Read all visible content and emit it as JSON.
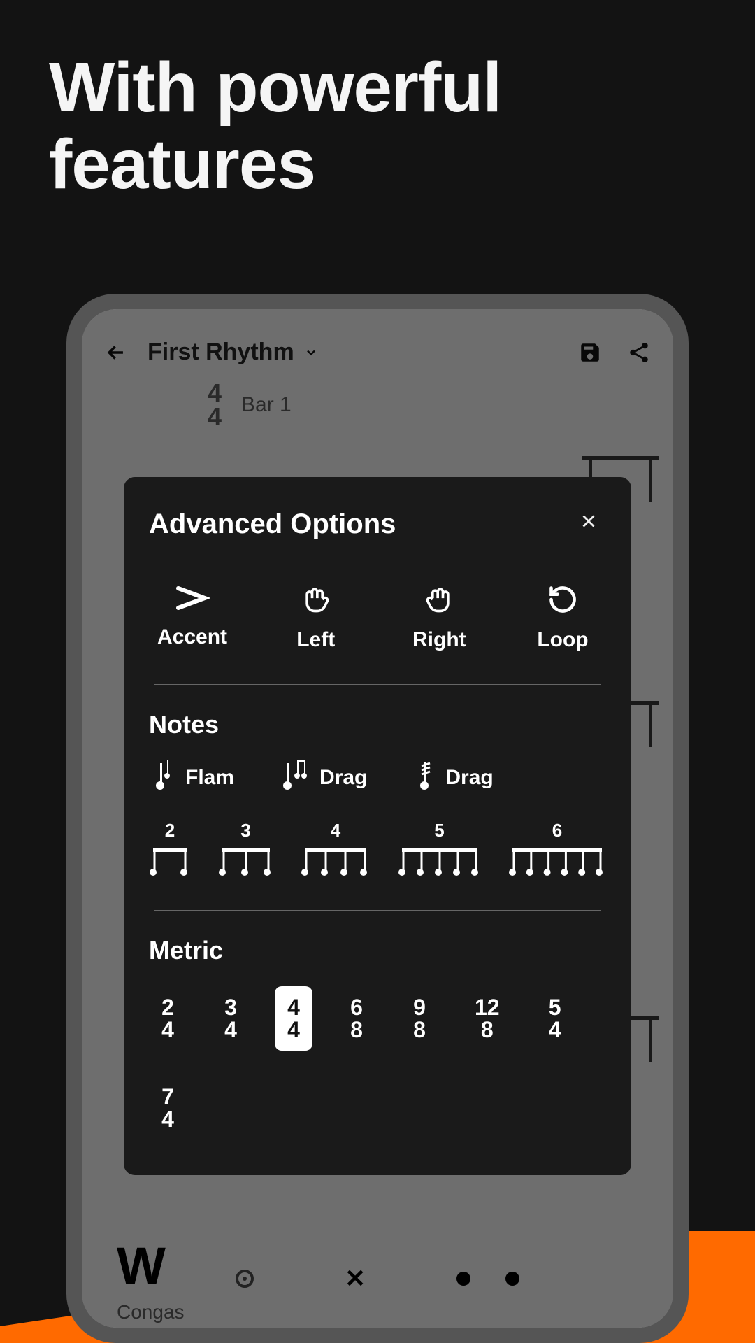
{
  "headline": "With powerful features",
  "screen": {
    "title": "First Rhythm",
    "timeSigTop": "4",
    "timeSigBottom": "4",
    "barLabel": "Bar 1",
    "instrument": "Congas"
  },
  "modal": {
    "title": "Advanced Options",
    "options": {
      "accent": "Accent",
      "left": "Left",
      "right": "Right",
      "loop": "Loop"
    },
    "notesTitle": "Notes",
    "rudiments": {
      "flam": "Flam",
      "drag1": "Drag",
      "drag2": "Drag"
    },
    "tuplets": [
      "2",
      "3",
      "4",
      "5",
      "6"
    ],
    "metricTitle": "Metric",
    "metrics": [
      {
        "top": "2",
        "bottom": "4",
        "selected": false
      },
      {
        "top": "3",
        "bottom": "4",
        "selected": false
      },
      {
        "top": "4",
        "bottom": "4",
        "selected": true
      },
      {
        "top": "6",
        "bottom": "8",
        "selected": false
      },
      {
        "top": "9",
        "bottom": "8",
        "selected": false
      },
      {
        "top": "12",
        "bottom": "8",
        "selected": false
      },
      {
        "top": "5",
        "bottom": "4",
        "selected": false
      },
      {
        "top": "7",
        "bottom": "4",
        "selected": false
      }
    ]
  }
}
